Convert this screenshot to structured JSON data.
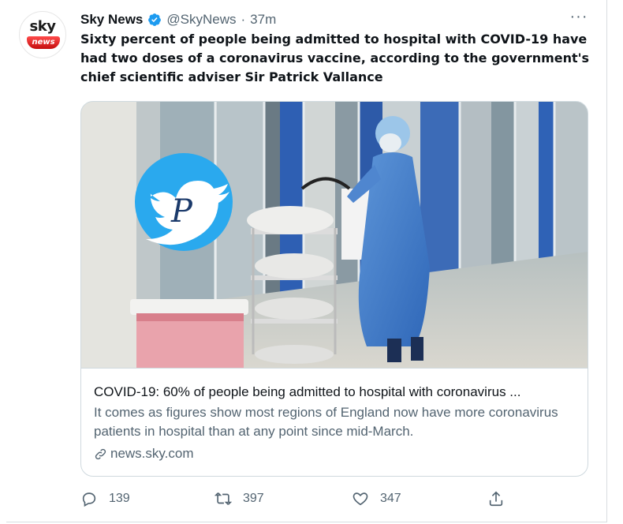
{
  "author": {
    "avatar_text": "sky",
    "avatar_badge": "news",
    "name": "Sky News",
    "handle": "@SkyNews",
    "separator": "·",
    "time": "37m",
    "verified_color": "#1d9bf0"
  },
  "more_label": "···",
  "tweet": {
    "text": "Sixty percent of people being admitted to hospital with COVID-19 have had two doses of a coronavirus vaccine, according to the government's chief scientific adviser Sir Patrick Vallance"
  },
  "card": {
    "image_alt": "Hospital ward with a health worker in blue protective gown pushing a trolley",
    "watermark_icon": "twitter-bird-icon",
    "watermark_letter": "P",
    "title": "COVID-19: 60% of people being admitted to hospital with coronavirus ...",
    "description": "It comes as figures show most regions of England now have more coronavirus patients in hospital than at any point since mid-March.",
    "domain": "news.sky.com"
  },
  "actions": {
    "reply_count": "139",
    "retweet_count": "397",
    "like_count": "347"
  },
  "colors": {
    "accent": "#1d9bf0",
    "text_primary": "#0f1419",
    "text_secondary": "#536471",
    "border": "#cfd9de"
  }
}
